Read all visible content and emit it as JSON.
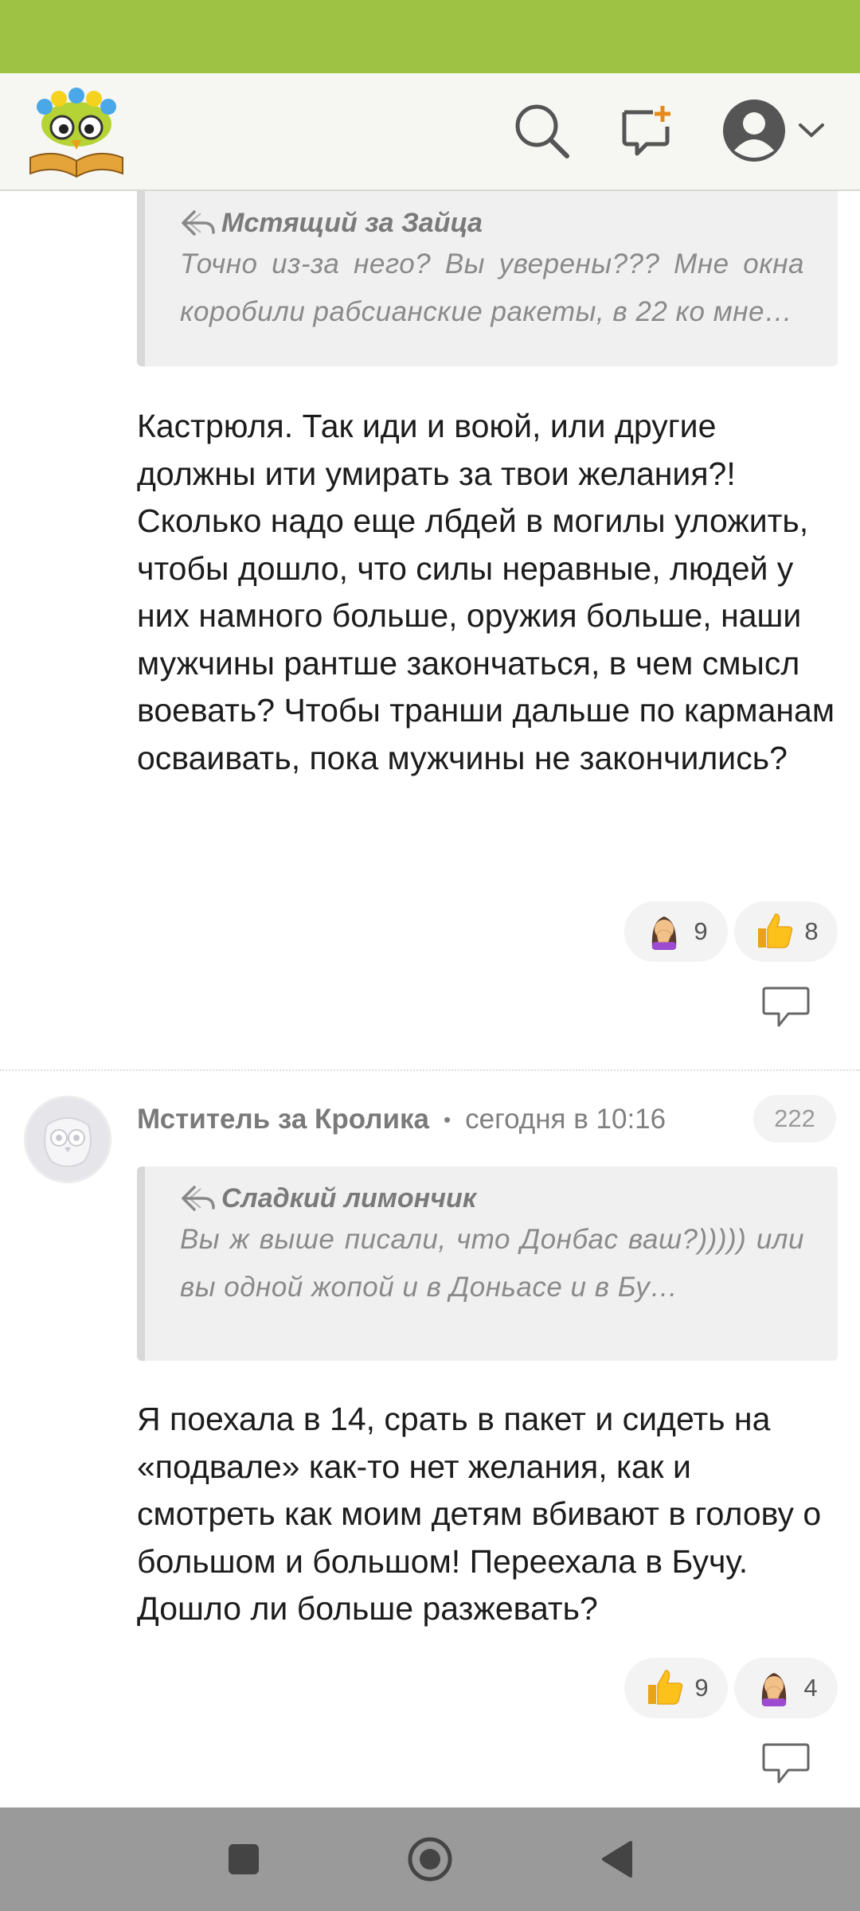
{
  "header": {
    "logo_icon": "book-owl-logo",
    "search_icon": "search-icon",
    "new_topic_icon": "new-topic-icon",
    "profile_icon": "user-avatar-icon",
    "accent_color": "#9dc244"
  },
  "comments": [
    {
      "quote": {
        "author": "Мстящий за Зайца",
        "text": "Точно из-за него? Вы уверены??? Мне окна коробили рабсианские ракеты, в 22 ко мне…"
      },
      "text": "Кастрюля. Так иди и воюй, или другие должны ити умирать за твои желания?! Сколько надо еще лбдей в могилы уложить, чтобы дошло, что силы неравные, людей у них намного больше, оружия больше, наши мужчины рантше закончаться, в чем смысл воевать? Чтобы транши дальше по карманам осваивать, пока мужчины не закончились?",
      "reactions": [
        {
          "icon": "facepalm-emoji",
          "count": "9"
        },
        {
          "icon": "thumbs-up-emoji",
          "count": "8"
        }
      ]
    },
    {
      "author": "Мститель за Кролика",
      "separator": "•",
      "time": "сегодня в 10:16",
      "number": "222",
      "quote": {
        "author": "Сладкий лимончик",
        "text": "Вы ж выше писали, что Донбас ваш?))))) или вы одной жопой и в Доньасе и в Бу…"
      },
      "text": "Я поехала в 14, срать в пакет и сидеть на «подвале» как-то нет желания, как и смотреть как моим детям вбивают в голову о большом и большом! Переехала в Бучу. Дошло ли больше разжевать?",
      "reactions": [
        {
          "icon": "thumbs-up-emoji",
          "count": "9"
        },
        {
          "icon": "facepalm-emoji",
          "count": "4"
        }
      ]
    }
  ],
  "navbar": {
    "recents_icon": "square-icon",
    "home_icon": "circle-icon",
    "back_icon": "back-triangle-icon"
  }
}
